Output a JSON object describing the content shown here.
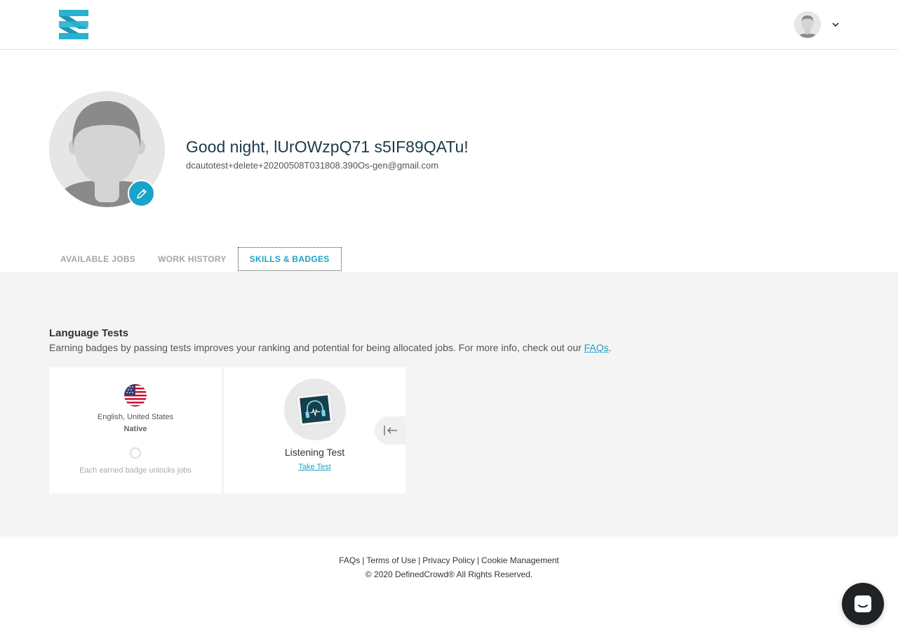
{
  "header": {
    "logo_icon": "definedcrowd-logo-icon",
    "user_avatar_icon": "user-avatar-icon",
    "dropdown_icon": "chevron-down-icon"
  },
  "profile": {
    "greeting": "Good night, lUrOWzpQ71 s5IF89QATu!",
    "email": "dcautotest+delete+20200508T031808.390Os-gen@gmail.com",
    "edit_icon": "pencil-icon"
  },
  "tabs": [
    {
      "label": "AVAILABLE JOBS",
      "active": false
    },
    {
      "label": "WORK HISTORY",
      "active": false
    },
    {
      "label": "SKILLS & BADGES",
      "active": true
    }
  ],
  "language_tests": {
    "title": "Language Tests",
    "description": "Earning badges by passing tests improves your ranking and potential for being allocated jobs. For more info, check out our ",
    "faq_link": "FAQs",
    "description_end": ".",
    "language_card": {
      "flag_icon": "us-flag-icon",
      "language": "English, United States",
      "level": "Native",
      "badge_note": "Each earned badge unlocks jobs"
    },
    "test_card": {
      "icon": "headphones-icon",
      "name": "Listening Test",
      "action": "Take Test",
      "collapse_icon": "collapse-left-icon"
    }
  },
  "footer": {
    "links": [
      "FAQs",
      "Terms of Use",
      "Privacy Policy",
      "Cookie Management"
    ],
    "separator": "|",
    "copyright": "© 2020 DefinedCrowd® All Rights Reserved."
  },
  "chat": {
    "icon": "chat-icon"
  },
  "colors": {
    "accent": "#1aa3c9",
    "heading": "#1a3a4a",
    "background_gray": "#f4f4f4",
    "chat_button": "#1f2326"
  }
}
